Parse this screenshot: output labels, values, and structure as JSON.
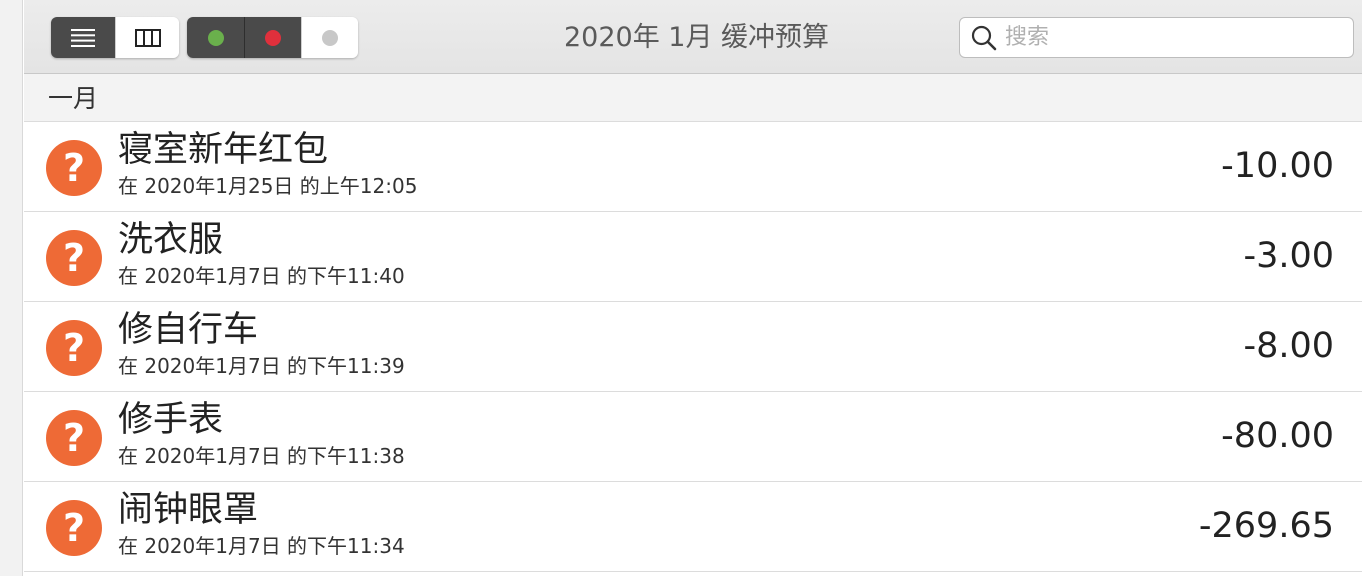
{
  "window": {
    "title": "2020年 1月 缓冲预算"
  },
  "toolbar": {
    "view_buttons": [
      {
        "icon": "list-icon",
        "active": true
      },
      {
        "icon": "columns-icon",
        "active": false
      }
    ],
    "filter_buttons": [
      {
        "icon": "green-dot-icon",
        "color": "#6ab04c",
        "active": true
      },
      {
        "icon": "red-dot-icon",
        "color": "#e0303c",
        "active": true
      },
      {
        "icon": "gray-dot-icon",
        "color": "#c8c8c8",
        "active": false
      }
    ]
  },
  "search": {
    "placeholder": "搜索",
    "value": ""
  },
  "section": {
    "title": "一月"
  },
  "transactions": [
    {
      "name": "寝室新年红包",
      "date": "在 2020年1月25日 的上午12:05",
      "amount": "-10.00",
      "status_icon": "?"
    },
    {
      "name": "洗衣服",
      "date": "在 2020年1月7日 的下午11:40",
      "amount": "-3.00",
      "status_icon": "?"
    },
    {
      "name": "修自行车",
      "date": "在 2020年1月7日 的下午11:39",
      "amount": "-8.00",
      "status_icon": "?"
    },
    {
      "name": "修手表",
      "date": "在 2020年1月7日 的下午11:38",
      "amount": "-80.00",
      "status_icon": "?"
    },
    {
      "name": "闹钟眼罩",
      "date": "在 2020年1月7日 的下午11:34",
      "amount": "-269.65",
      "status_icon": "?"
    }
  ],
  "colors": {
    "accent_badge": "#ee6a36",
    "segment_active": "#4a4a4a"
  }
}
